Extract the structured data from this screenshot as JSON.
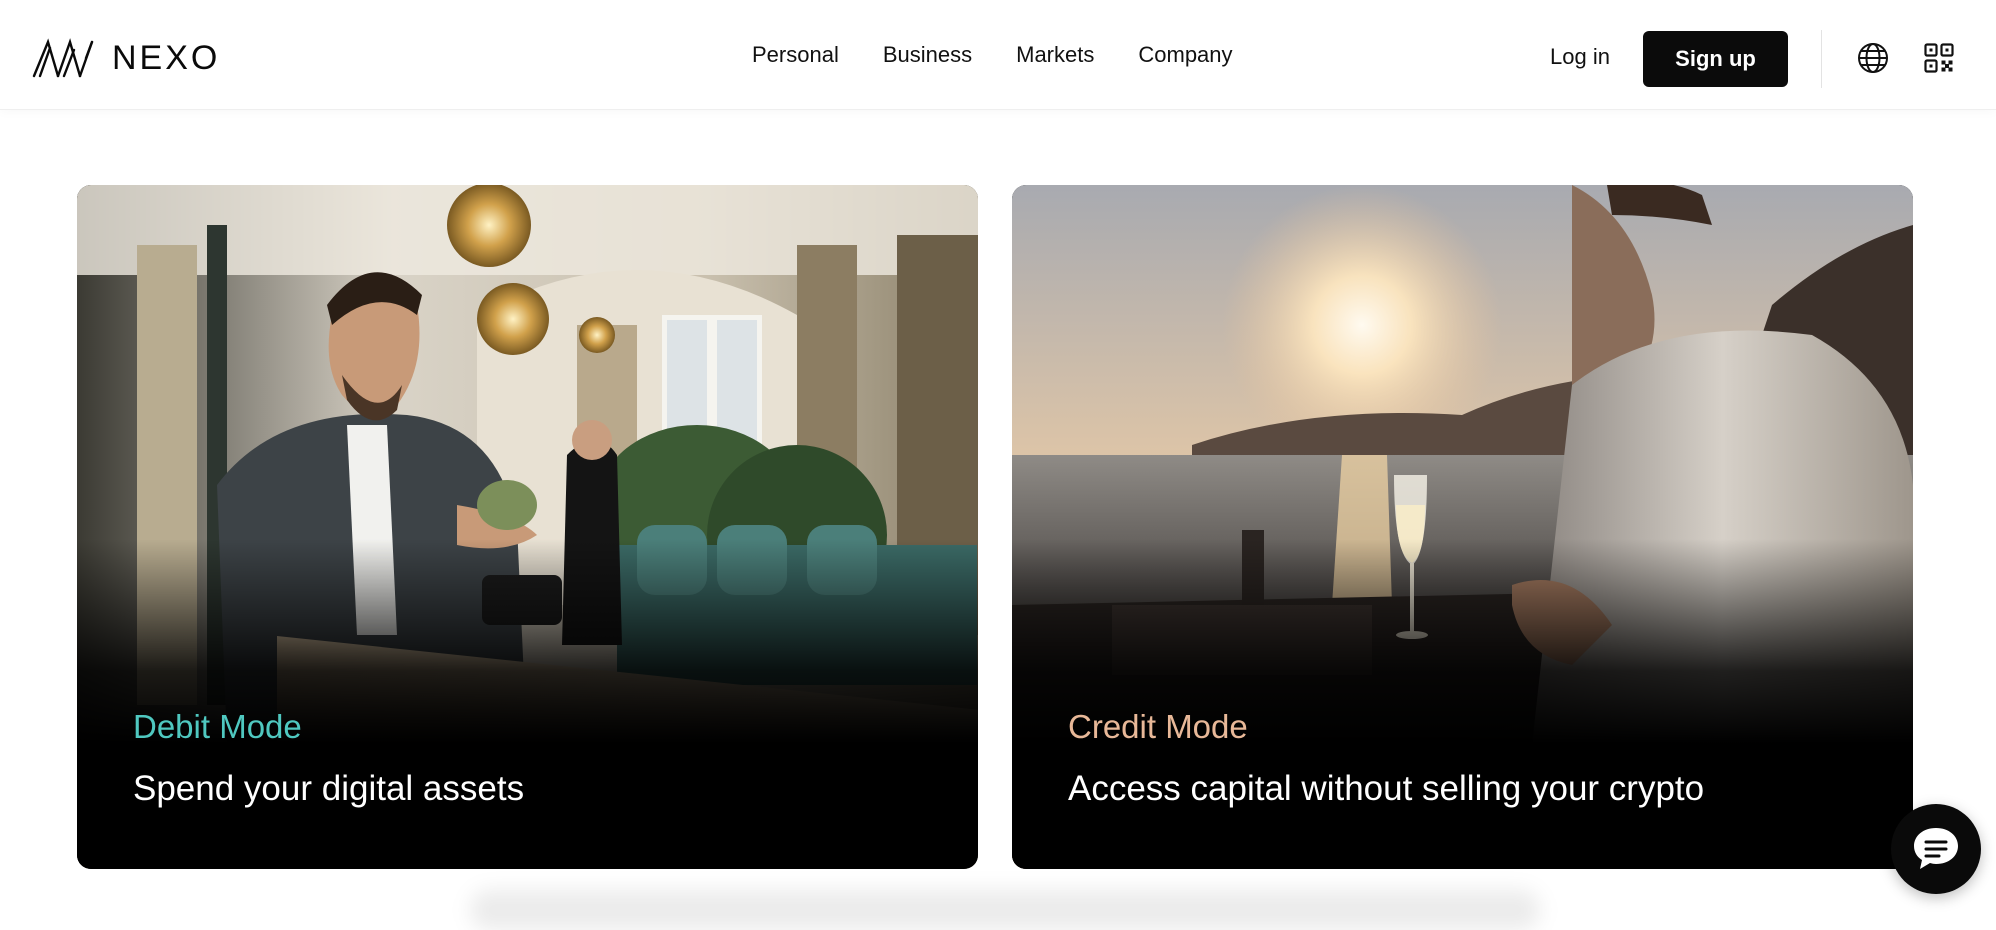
{
  "brand": {
    "name": "NEXO",
    "icon": "nexo-logo-icon"
  },
  "nav": {
    "items": [
      {
        "label": "Personal"
      },
      {
        "label": "Business"
      },
      {
        "label": "Markets"
      },
      {
        "label": "Company"
      }
    ]
  },
  "header_actions": {
    "login_label": "Log in",
    "signup_label": "Sign up",
    "language_icon": "globe-icon",
    "qr_icon": "qr-code-icon"
  },
  "cards": [
    {
      "eyebrow": "Debit Mode",
      "title": "Spend your digital assets",
      "accent_color": "#4fc8c0"
    },
    {
      "eyebrow": "Credit Mode",
      "title": "Access capital without selling your crypto",
      "accent_color": "#e8b898"
    }
  ],
  "chat": {
    "icon": "chat-bubble-icon"
  },
  "colors": {
    "primary": "#0b0b0b",
    "background": "#ffffff",
    "debit_accent": "#4fc8c0",
    "credit_accent": "#e8b898"
  }
}
